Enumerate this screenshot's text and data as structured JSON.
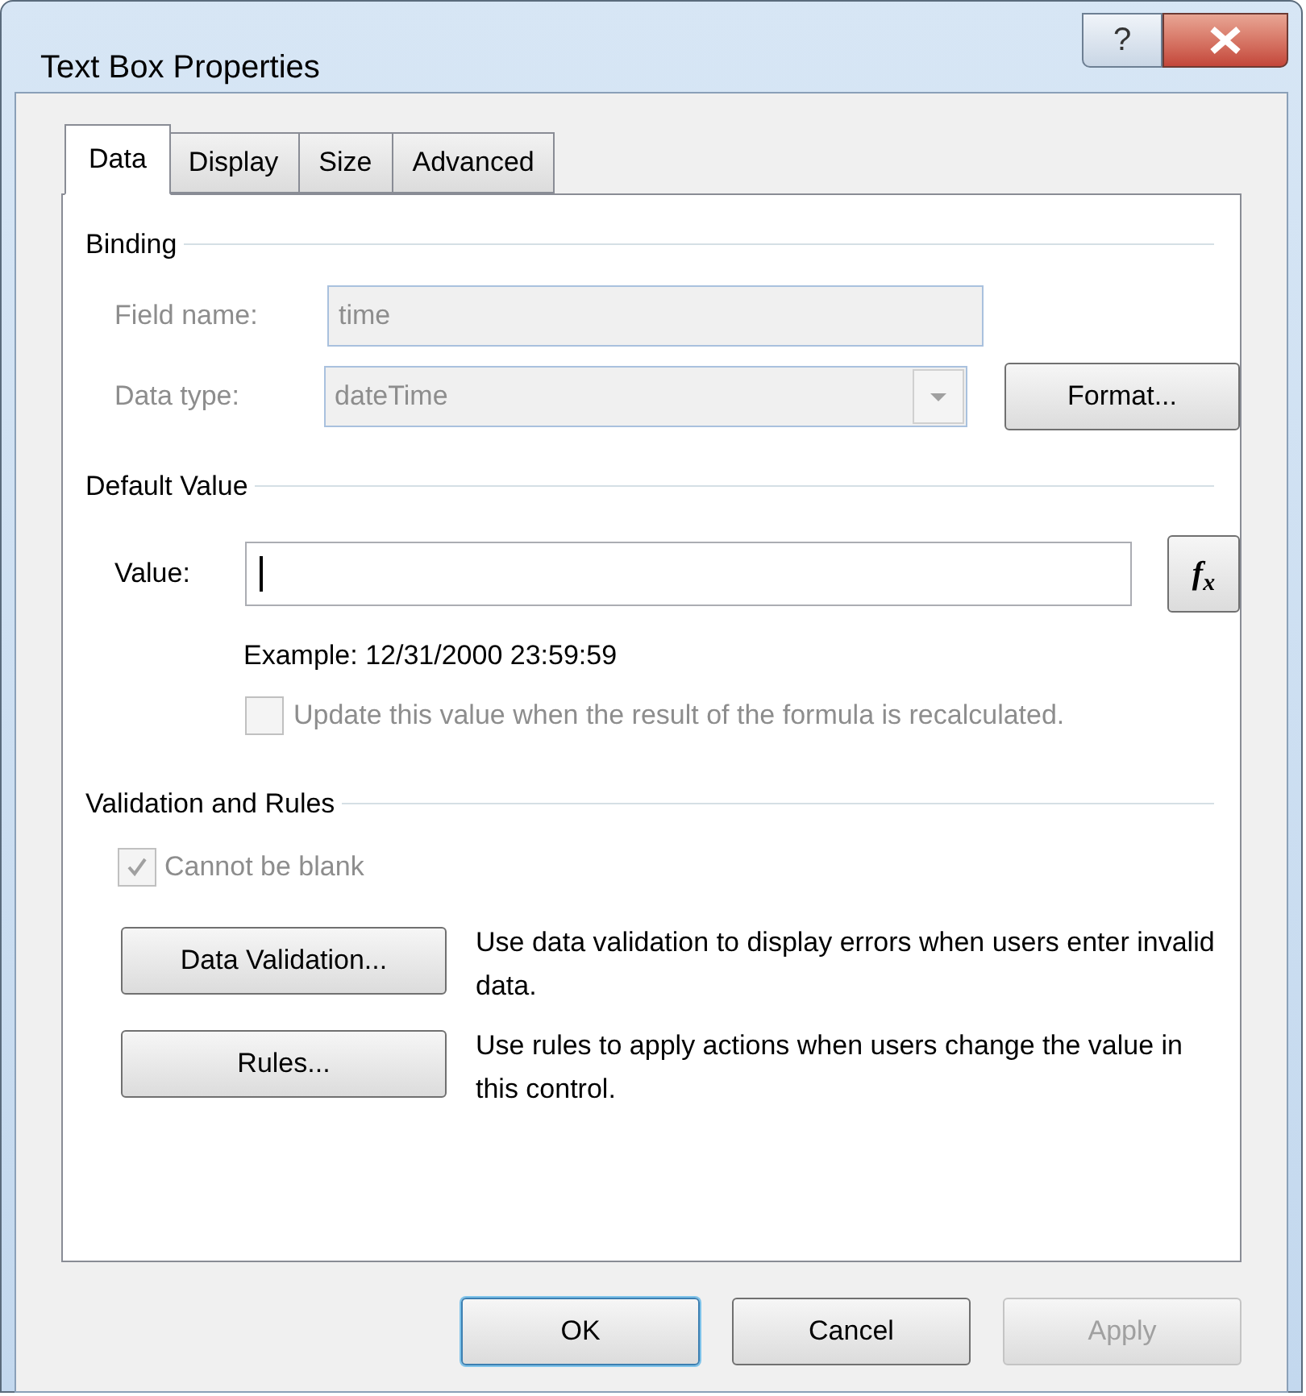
{
  "window": {
    "title": "Text Box Properties",
    "help_button": "?"
  },
  "tabs": [
    {
      "label": "Data",
      "selected": true
    },
    {
      "label": "Display",
      "selected": false
    },
    {
      "label": "Size",
      "selected": false
    },
    {
      "label": "Advanced",
      "selected": false
    }
  ],
  "binding": {
    "title": "Binding",
    "field_name": {
      "label": "Field name:",
      "value": "time",
      "disabled": true
    },
    "data_type": {
      "label": "Data type:",
      "value": "dateTime",
      "disabled": true
    },
    "format_button": "Format..."
  },
  "default_value": {
    "title": "Default Value",
    "label": "Value:",
    "focused": true,
    "formula_button": "f$_{x}$",
    "example": "Example: 12/31/2000 23:59:59",
    "update_checkbox": {
      "label": "Update this value when the result of the formula is recalculated.",
      "checked": false,
      "disabled": true
    }
  },
  "validation": {
    "title": "Validation and Rules",
    "blank_checkbox": {
      "label": "Cannot be blank",
      "checked": true,
      "disabled": true
    },
    "actions": [
      {
        "button": "Data Validation...",
        "description": "Use data validation to display errors when users enter invalid data."
      },
      {
        "button": "Rules...",
        "description": "Use rules to apply actions when users change the value in this control."
      }
    ]
  },
  "buttons": [
    {
      "label": "OK",
      "default": true,
      "disabled": false
    },
    {
      "label": "Cancel",
      "default": false,
      "disabled": false
    },
    {
      "label": "Apply",
      "default": false,
      "disabled": true
    }
  ]
}
